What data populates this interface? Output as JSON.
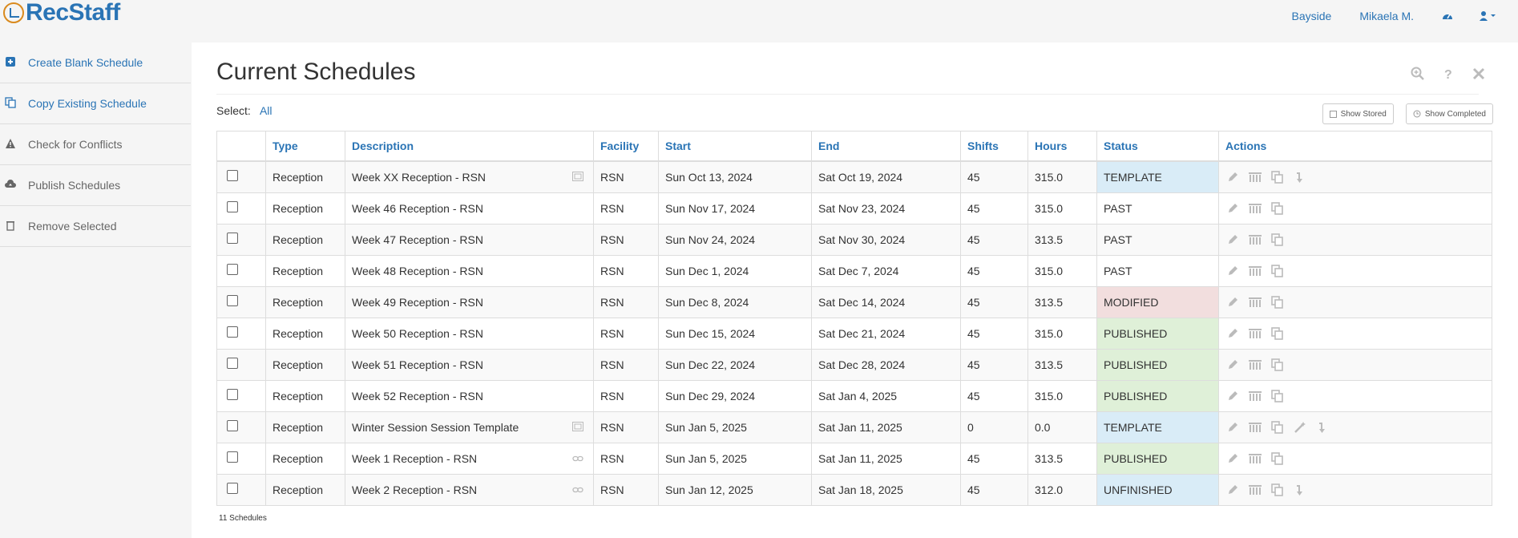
{
  "app": {
    "logo_text": "RecStaff"
  },
  "topnav": {
    "location": "Bayside",
    "user": "Mikaela M."
  },
  "sidebar": {
    "items": [
      {
        "label": "Create Blank Schedule",
        "icon": "plus-square-icon"
      },
      {
        "label": "Copy Existing Schedule",
        "icon": "copy-icon"
      },
      {
        "label": "Check for Conflicts",
        "icon": "warning-icon"
      },
      {
        "label": "Publish Schedules",
        "icon": "cloud-upload-icon"
      },
      {
        "label": "Remove Selected",
        "icon": "trash-icon"
      }
    ]
  },
  "page": {
    "title": "Current Schedules",
    "select_label": "Select:",
    "select_all": "All",
    "show_stored": "Show Stored",
    "show_completed": "Show Completed",
    "footer_count": "11 Schedules"
  },
  "table": {
    "headers": [
      "Type",
      "Description",
      "Facility",
      "Start",
      "End",
      "Shifts",
      "Hours",
      "Status",
      "Actions"
    ],
    "rows": [
      {
        "type": "Reception",
        "description": "Week XX Reception - RSN",
        "desc_icon": "template-icon",
        "facility": "RSN",
        "start": "Sun Oct 13, 2024",
        "end": "Sat Oct 19, 2024",
        "shifts": "45",
        "hours": "315.0",
        "status": "TEMPLATE",
        "status_class": "s-template",
        "actions": [
          "edit",
          "view",
          "copy",
          "download"
        ]
      },
      {
        "type": "Reception",
        "description": "Week 46 Reception - RSN",
        "desc_icon": "",
        "facility": "RSN",
        "start": "Sun Nov 17, 2024",
        "end": "Sat Nov 23, 2024",
        "shifts": "45",
        "hours": "315.0",
        "status": "PAST",
        "status_class": "",
        "actions": [
          "edit",
          "view",
          "copy"
        ]
      },
      {
        "type": "Reception",
        "description": "Week 47 Reception - RSN",
        "desc_icon": "",
        "facility": "RSN",
        "start": "Sun Nov 24, 2024",
        "end": "Sat Nov 30, 2024",
        "shifts": "45",
        "hours": "313.5",
        "status": "PAST",
        "status_class": "",
        "actions": [
          "edit",
          "view",
          "copy"
        ]
      },
      {
        "type": "Reception",
        "description": "Week 48 Reception - RSN",
        "desc_icon": "",
        "facility": "RSN",
        "start": "Sun Dec 1, 2024",
        "end": "Sat Dec 7, 2024",
        "shifts": "45",
        "hours": "315.0",
        "status": "PAST",
        "status_class": "",
        "actions": [
          "edit",
          "view",
          "copy"
        ]
      },
      {
        "type": "Reception",
        "description": "Week 49 Reception - RSN",
        "desc_icon": "",
        "facility": "RSN",
        "start": "Sun Dec 8, 2024",
        "end": "Sat Dec 14, 2024",
        "shifts": "45",
        "hours": "313.5",
        "status": "MODIFIED",
        "status_class": "s-modified",
        "actions": [
          "edit",
          "view",
          "copy"
        ]
      },
      {
        "type": "Reception",
        "description": "Week 50 Reception - RSN",
        "desc_icon": "",
        "facility": "RSN",
        "start": "Sun Dec 15, 2024",
        "end": "Sat Dec 21, 2024",
        "shifts": "45",
        "hours": "315.0",
        "status": "PUBLISHED",
        "status_class": "s-published",
        "actions": [
          "edit",
          "view",
          "copy"
        ]
      },
      {
        "type": "Reception",
        "description": "Week 51 Reception - RSN",
        "desc_icon": "",
        "facility": "RSN",
        "start": "Sun Dec 22, 2024",
        "end": "Sat Dec 28, 2024",
        "shifts": "45",
        "hours": "313.5",
        "status": "PUBLISHED",
        "status_class": "s-published",
        "actions": [
          "edit",
          "view",
          "copy"
        ]
      },
      {
        "type": "Reception",
        "description": "Week 52 Reception - RSN",
        "desc_icon": "",
        "facility": "RSN",
        "start": "Sun Dec 29, 2024",
        "end": "Sat Jan 4, 2025",
        "shifts": "45",
        "hours": "315.0",
        "status": "PUBLISHED",
        "status_class": "s-published",
        "actions": [
          "edit",
          "view",
          "copy"
        ]
      },
      {
        "type": "Reception",
        "description": "Winter Session Session Template",
        "desc_icon": "template-icon",
        "facility": "RSN",
        "start": "Sun Jan 5, 2025",
        "end": "Sat Jan 11, 2025",
        "shifts": "0",
        "hours": "0.0",
        "status": "TEMPLATE",
        "status_class": "s-template",
        "actions": [
          "edit",
          "view",
          "copy",
          "wand",
          "download"
        ]
      },
      {
        "type": "Reception",
        "description": "Week 1 Reception - RSN",
        "desc_icon": "link-icon",
        "facility": "RSN",
        "start": "Sun Jan 5, 2025",
        "end": "Sat Jan 11, 2025",
        "shifts": "45",
        "hours": "313.5",
        "status": "PUBLISHED",
        "status_class": "s-published",
        "actions": [
          "edit",
          "view",
          "copy"
        ]
      },
      {
        "type": "Reception",
        "description": "Week 2 Reception - RSN",
        "desc_icon": "link-icon",
        "facility": "RSN",
        "start": "Sun Jan 12, 2025",
        "end": "Sat Jan 18, 2025",
        "shifts": "45",
        "hours": "312.0",
        "status": "UNFINISHED",
        "status_class": "s-unfinished",
        "actions": [
          "edit",
          "view",
          "copy",
          "download"
        ]
      }
    ]
  }
}
